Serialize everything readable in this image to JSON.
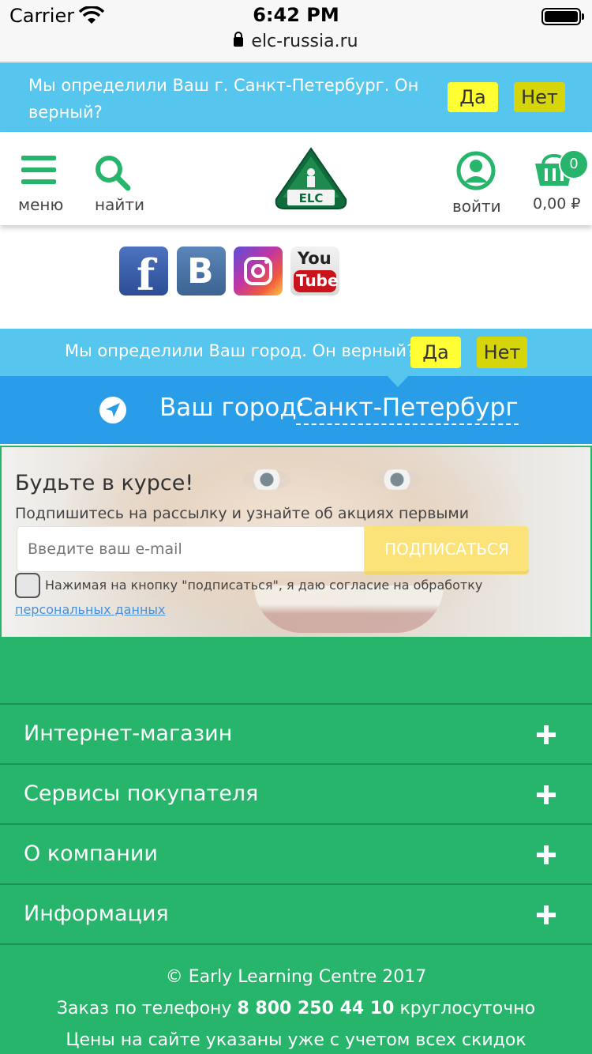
{
  "status_bar": {
    "carrier": "Carrier",
    "time": "6:42 PM",
    "url": "elc-russia.ru"
  },
  "city_banner_top": {
    "text": "Мы определили Ваш г. Санкт-Петербург. Он верный?",
    "yes": "Да",
    "no": "Нет"
  },
  "header": {
    "menu_label": "меню",
    "search_label": "найти",
    "logo_text": "ELC",
    "login_label": "войти",
    "cart_count": "0",
    "cart_total": "0,00 ₽"
  },
  "social": {
    "fb": "f",
    "vk": "B",
    "yt_you": "You",
    "yt_tube": "Tube"
  },
  "city_confirm": {
    "text": "Мы определили Ваш город. Он верный?",
    "yes": "Да",
    "no": "Нет"
  },
  "city_current": {
    "label": "Ваш город:",
    "name": "Санкт-Петербург"
  },
  "newsletter": {
    "title": "Будьте в курсе!",
    "subtitle": "Подпишитесь на рассылку и узнайте об акциях первыми",
    "email_placeholder": "Введите ваш e-mail",
    "submit": "ПОДПИСАТЬСЯ",
    "consent": "Нажимая на кнопку \"подписаться\", я даю согласие на обработку",
    "consent_link": "персональных данных"
  },
  "footer": {
    "sections": [
      {
        "label": "Интернет-магазин"
      },
      {
        "label": "Сервисы покупателя"
      },
      {
        "label": "О компании"
      },
      {
        "label": "Информация"
      }
    ],
    "copyright": "© Early Learning Centre 2017",
    "phone_prefix": "Заказ по телефону",
    "phone": "8 800 250 44 10",
    "phone_suffix": "круглосуточно",
    "prices_note": "Цены на сайте указаны уже с учетом всех скидок"
  },
  "colors": {
    "brand_green": "#27b56b",
    "banner_blue": "#56c6ee",
    "city_blue": "#2a9de8",
    "yes_yellow": "#ffff33",
    "no_olive": "#d5d50a"
  }
}
